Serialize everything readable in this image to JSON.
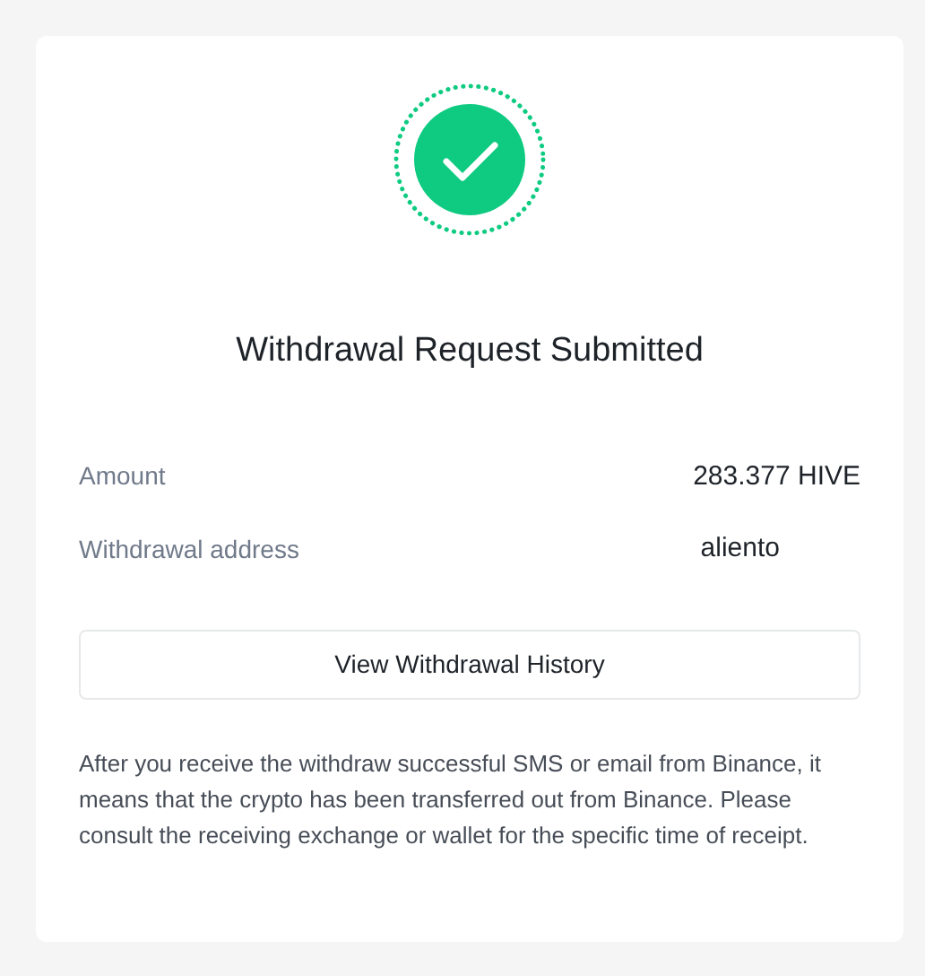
{
  "title": "Withdrawal Request Submitted",
  "details": [
    {
      "label": "Amount",
      "value": "283.377 HIVE",
      "kind": "amount"
    },
    {
      "label": "Withdrawal address",
      "value": "aliento",
      "kind": "address"
    }
  ],
  "button": "View Withdrawal History",
  "note": "After you receive the withdraw successful SMS or email from Binance, it means that the crypto has been transferred out from Binance. Please consult the receiving exchange or wallet for the specific time of receipt."
}
